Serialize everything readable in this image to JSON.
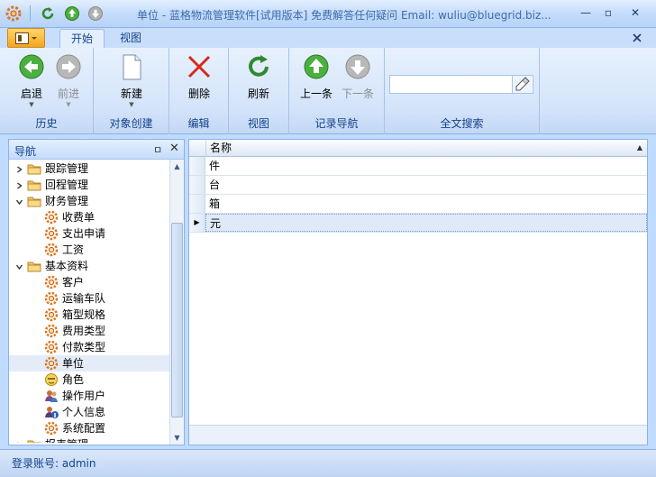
{
  "window": {
    "title": "单位 - 蓝格物流管理软件[试用版本] 免费解答任何疑问 Email: wuliu@bluegrid.biz...",
    "minimize": "—",
    "restore": "▫",
    "close": "✕"
  },
  "ribbon": {
    "tabs": [
      {
        "label": "开始"
      },
      {
        "label": "视图"
      }
    ],
    "groups": [
      {
        "label": "历史",
        "buttons": [
          {
            "label": "启退"
          },
          {
            "label": "前进"
          }
        ]
      },
      {
        "label": "对象创建",
        "buttons": [
          {
            "label": "新建"
          }
        ]
      },
      {
        "label": "编辑",
        "buttons": [
          {
            "label": "删除"
          }
        ]
      },
      {
        "label": "视图",
        "buttons": [
          {
            "label": "刷新"
          }
        ]
      },
      {
        "label": "记录导航",
        "buttons": [
          {
            "label": "上一条"
          },
          {
            "label": "下一条"
          }
        ]
      },
      {
        "label": "全文搜索"
      }
    ],
    "search": {
      "value": "",
      "placeholder": ""
    }
  },
  "nav": {
    "title": "导航",
    "pin": "ㅁ",
    "close": "✕",
    "items": [
      {
        "label": "跟踪管理",
        "level": 0,
        "icon": "folder-icon",
        "expander": "›"
      },
      {
        "label": "回程管理",
        "level": 0,
        "icon": "folder-icon",
        "expander": "›"
      },
      {
        "label": "财务管理",
        "level": 0,
        "icon": "folder-icon",
        "expander": "⌄"
      },
      {
        "label": "收费单",
        "level": 1,
        "icon": "gear-icon"
      },
      {
        "label": "支出申请",
        "level": 1,
        "icon": "gear-icon"
      },
      {
        "label": "工资",
        "level": 1,
        "icon": "gear-icon"
      },
      {
        "label": "基本资料",
        "level": 0,
        "icon": "folder-icon",
        "expander": "⌄"
      },
      {
        "label": "客户",
        "level": 1,
        "icon": "gear-icon"
      },
      {
        "label": "运输车队",
        "level": 1,
        "icon": "gear-icon"
      },
      {
        "label": "箱型规格",
        "level": 1,
        "icon": "gear-icon"
      },
      {
        "label": "费用类型",
        "level": 1,
        "icon": "gear-icon"
      },
      {
        "label": "付款类型",
        "level": 1,
        "icon": "gear-icon"
      },
      {
        "label": "单位",
        "level": 1,
        "icon": "gear-icon",
        "selected": true
      },
      {
        "label": "角色",
        "level": 1,
        "icon": "role-icon"
      },
      {
        "label": "操作用户",
        "level": 1,
        "icon": "users-icon"
      },
      {
        "label": "个人信息",
        "level": 1,
        "icon": "user-info-icon"
      },
      {
        "label": "系统配置",
        "level": 1,
        "icon": "gear-icon"
      },
      {
        "label": "报表管理",
        "level": 0,
        "icon": "folder-icon",
        "expander": "›"
      }
    ]
  },
  "grid": {
    "column": "名称",
    "sort_indicator": "▲",
    "rows": [
      "件",
      "台",
      "箱",
      "元"
    ],
    "current_row": 3,
    "row_indicator": "▶"
  },
  "status": {
    "login": "登录账号: admin"
  }
}
